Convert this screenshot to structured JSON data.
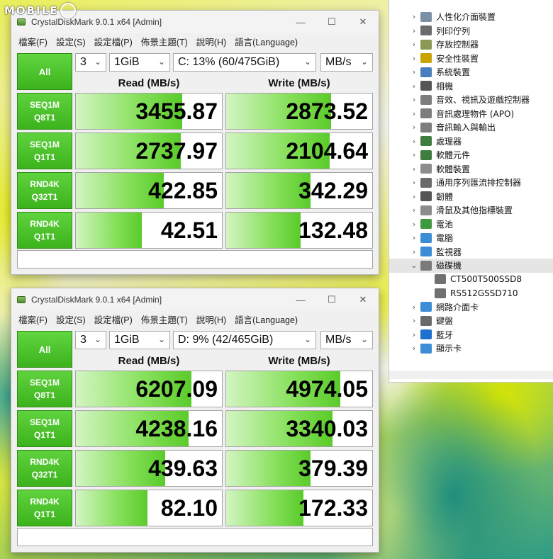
{
  "watermark": {
    "text": "MOBILE"
  },
  "cdm_windows": [
    {
      "title": "CrystalDiskMark 9.0.1 x64 [Admin]",
      "menu": [
        "檔案(F)",
        "設定(S)",
        "設定檔(P)",
        "佈景主題(T)",
        "說明(H)",
        "語言(Language)"
      ],
      "all_label": "All",
      "count": "3",
      "size": "1GiB",
      "drive": "C: 13% (60/475GiB)",
      "unit": "MB/s",
      "read_header": "Read (MB/s)",
      "write_header": "Write (MB/s)",
      "rows": [
        {
          "label1": "SEQ1M",
          "label2": "Q8T1",
          "read": "3455.87",
          "write": "2873.52",
          "read_fill": 0.73,
          "write_fill": 0.72
        },
        {
          "label1": "SEQ1M",
          "label2": "Q1T1",
          "read": "2737.97",
          "write": "2104.64",
          "read_fill": 0.72,
          "write_fill": 0.71
        },
        {
          "label1": "RND4K",
          "label2": "Q32T1",
          "read": "422.85",
          "write": "342.29",
          "read_fill": 0.6,
          "write_fill": 0.58
        },
        {
          "label1": "RND4K",
          "label2": "Q1T1",
          "read": "42.51",
          "write": "132.48",
          "read_fill": 0.45,
          "write_fill": 0.51
        }
      ],
      "comment": ""
    },
    {
      "title": "CrystalDiskMark 9.0.1 x64 [Admin]",
      "menu": [
        "檔案(F)",
        "設定(S)",
        "設定檔(P)",
        "佈景主題(T)",
        "說明(H)",
        "語言(Language)"
      ],
      "all_label": "All",
      "count": "3",
      "size": "1GiB",
      "drive": "D: 9% (42/465GiB)",
      "unit": "MB/s",
      "read_header": "Read (MB/s)",
      "write_header": "Write (MB/s)",
      "rows": [
        {
          "label1": "SEQ1M",
          "label2": "Q8T1",
          "read": "6207.09",
          "write": "4974.05",
          "read_fill": 0.79,
          "write_fill": 0.78
        },
        {
          "label1": "SEQ1M",
          "label2": "Q1T1",
          "read": "4238.16",
          "write": "3340.03",
          "read_fill": 0.77,
          "write_fill": 0.73
        },
        {
          "label1": "RND4K",
          "label2": "Q32T1",
          "read": "439.63",
          "write": "379.39",
          "read_fill": 0.61,
          "write_fill": 0.58
        },
        {
          "label1": "RND4K",
          "label2": "Q1T1",
          "read": "82.10",
          "write": "172.33",
          "read_fill": 0.49,
          "write_fill": 0.53
        }
      ],
      "comment": ""
    }
  ],
  "device_manager": {
    "items": [
      {
        "label": "人性化介面裝置",
        "expanded": false,
        "icon_color": "#7a8fa6"
      },
      {
        "label": "列印佇列",
        "expanded": false,
        "icon_color": "#6b6b6b"
      },
      {
        "label": "存放控制器",
        "expanded": false,
        "icon_color": "#8a9a55"
      },
      {
        "label": "安全性裝置",
        "expanded": false,
        "icon_color": "#c9a400"
      },
      {
        "label": "系統裝置",
        "expanded": false,
        "icon_color": "#4a7fbf"
      },
      {
        "label": "相機",
        "expanded": false,
        "icon_color": "#555555"
      },
      {
        "label": "音效、視訊及遊戲控制器",
        "expanded": false,
        "icon_color": "#7d7d7d"
      },
      {
        "label": "音訊處理物件 (APO)",
        "expanded": false,
        "icon_color": "#7d7d7d"
      },
      {
        "label": "音訊輸入與輸出",
        "expanded": false,
        "icon_color": "#7d7d7d"
      },
      {
        "label": "處理器",
        "expanded": false,
        "icon_color": "#3e7d3e"
      },
      {
        "label": "軟體元件",
        "expanded": false,
        "icon_color": "#3e7d3e"
      },
      {
        "label": "軟體裝置",
        "expanded": false,
        "icon_color": "#8c8c8c"
      },
      {
        "label": "通用序列匯流排控制器",
        "expanded": false,
        "icon_color": "#6a6a6a"
      },
      {
        "label": "韌體",
        "expanded": false,
        "icon_color": "#555555"
      },
      {
        "label": "滑鼠及其他指標裝置",
        "expanded": false,
        "icon_color": "#8c8c8c"
      },
      {
        "label": "電池",
        "expanded": false,
        "icon_color": "#3f9a3f"
      },
      {
        "label": "電腦",
        "expanded": false,
        "icon_color": "#3c8dd6"
      },
      {
        "label": "監視器",
        "expanded": false,
        "icon_color": "#3c8dd6"
      },
      {
        "label": "磁碟機",
        "expanded": true,
        "icon_color": "#7a7a7a"
      },
      {
        "label": "CT500T500SSD8",
        "child": true,
        "icon_color": "#707070"
      },
      {
        "label": "RS512GSSD710",
        "child": true,
        "icon_color": "#707070"
      },
      {
        "label": "網路介面卡",
        "expanded": false,
        "icon_color": "#3c8dd6"
      },
      {
        "label": "鍵盤",
        "expanded": false,
        "icon_color": "#6a6a6a"
      },
      {
        "label": "藍牙",
        "expanded": false,
        "icon_color": "#1f6fd1"
      },
      {
        "label": "顯示卡",
        "expanded": false,
        "icon_color": "#3c8dd6"
      }
    ]
  }
}
